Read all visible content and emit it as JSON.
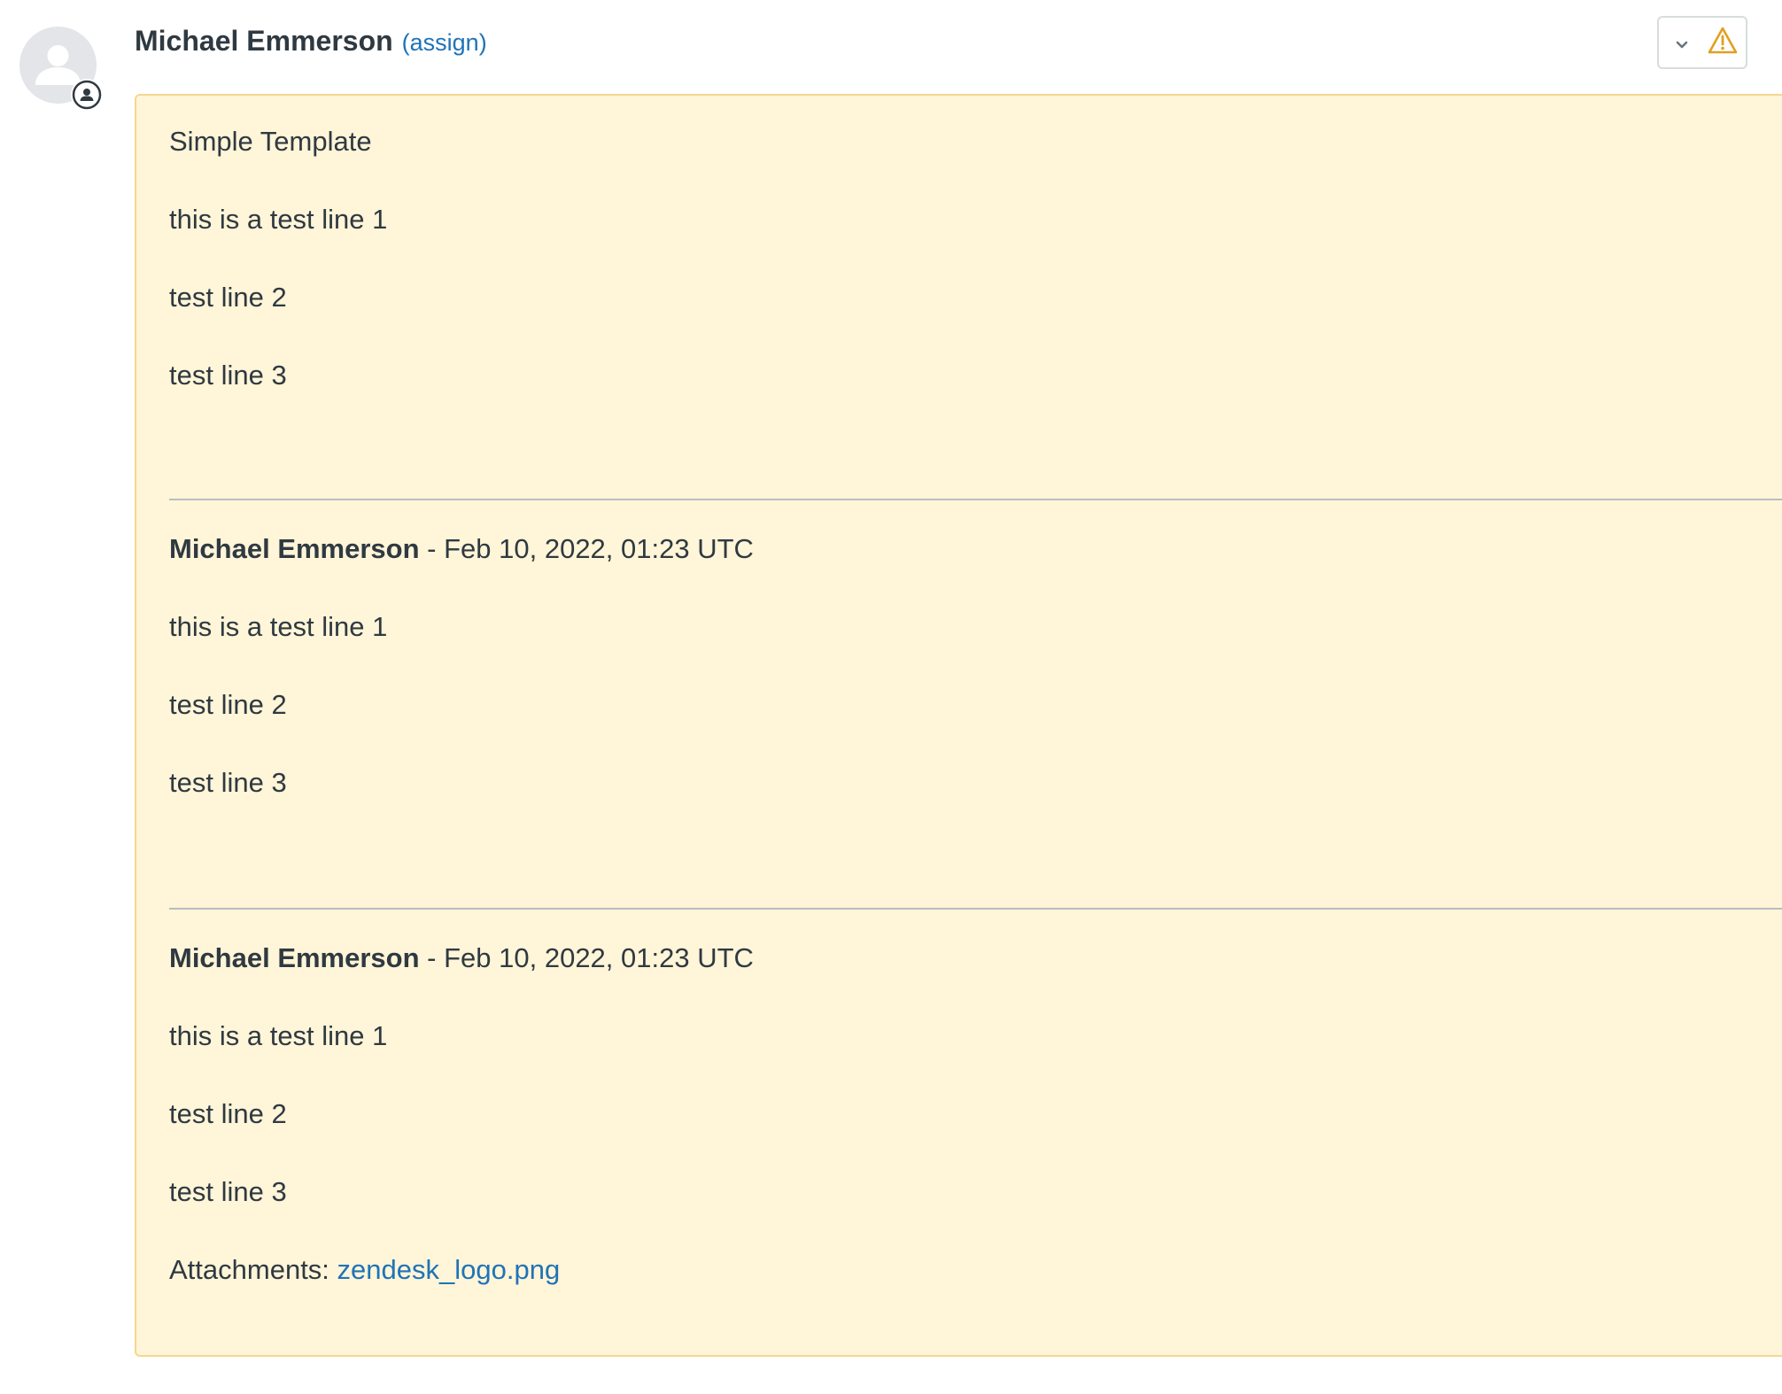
{
  "header": {
    "author_name": "Michael Emmerson",
    "assign_label": "(assign)"
  },
  "icons": {
    "avatar": "user-avatar-icon",
    "badge": "agent-badge-icon",
    "chevron": "chevron-down-icon",
    "warning": "warning-icon"
  },
  "colors": {
    "card_background": "#fff5d8",
    "card_border": "#f5d78e",
    "link": "#1f73b7",
    "warning": "#e0a020",
    "text": "#2f3941"
  },
  "comment": {
    "title": "Simple Template",
    "lines": [
      "this is a test line 1",
      "test line 2",
      "test line 3"
    ],
    "quoted": [
      {
        "author": "Michael Emmerson",
        "meta": " - Feb 10, 2022, 01:23 UTC",
        "lines": [
          "this is a test line 1",
          "test line 2",
          "test line 3"
        ]
      },
      {
        "author": "Michael Emmerson",
        "meta": " - Feb 10, 2022, 01:23 UTC",
        "lines": [
          "this is a test line 1",
          "test line 2",
          "test line 3"
        ]
      }
    ],
    "attachments_label": "Attachments: ",
    "attachment_file": "zendesk_logo.png"
  }
}
